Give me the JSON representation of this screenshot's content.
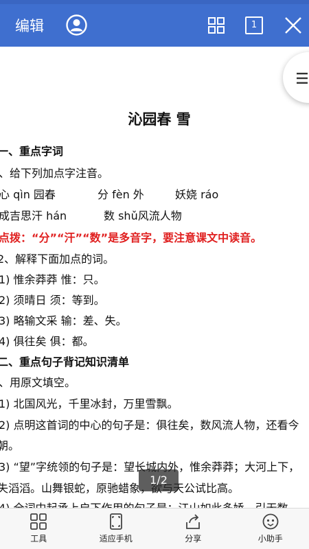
{
  "header": {
    "title": "编辑",
    "page_button_label": "1"
  },
  "document": {
    "title": "沁园春 雪",
    "lines": [
      "一、重点字词",
      "、给下列加点字注音。",
      "心 qìn 园春",
      "分 fèn 外",
      "妖娆 ráo",
      "成吉思汗 hán",
      "数 shǔ风流人物",
      "点拨：“分”“汗”“数”是多音字，要注意课文中读音。",
      "2、解释下面加点的词。",
      "1) 惟余莽莽  惟：只。",
      "2)  须晴日  须：等到。",
      "3)  略输文采  输：差、失。",
      "4)  俱往矣  俱：都。",
      "二、重点句子背记知识清单",
      "、用原文填空。",
      "1) 北国风光，千里冰封，万里雪飘。",
      "2) 点明这首词的中心的句子是：俱往矣，数风流人物，还看今",
      "朝。",
      "3) “望”字统领的句子是：望长城内外，惟余莽莽；大河上下，",
      "失滔滔。山舞银蛇，原驰蜡象，欲与天公试比高。",
      "4) 全词中起承上启下作用的句子是：江山如此多娇，引无数"
    ],
    "page_indicator": "1/2"
  },
  "bottom_nav": {
    "items": [
      {
        "label": "工具",
        "icon": "tools-icon"
      },
      {
        "label": "适应手机",
        "icon": "fit-screen-icon"
      },
      {
        "label": "分享",
        "icon": "share-icon"
      },
      {
        "label": "小助手",
        "icon": "assistant-icon"
      }
    ]
  },
  "colors": {
    "header_bg": "#3f6fcf",
    "highlight_text": "#e02020"
  }
}
